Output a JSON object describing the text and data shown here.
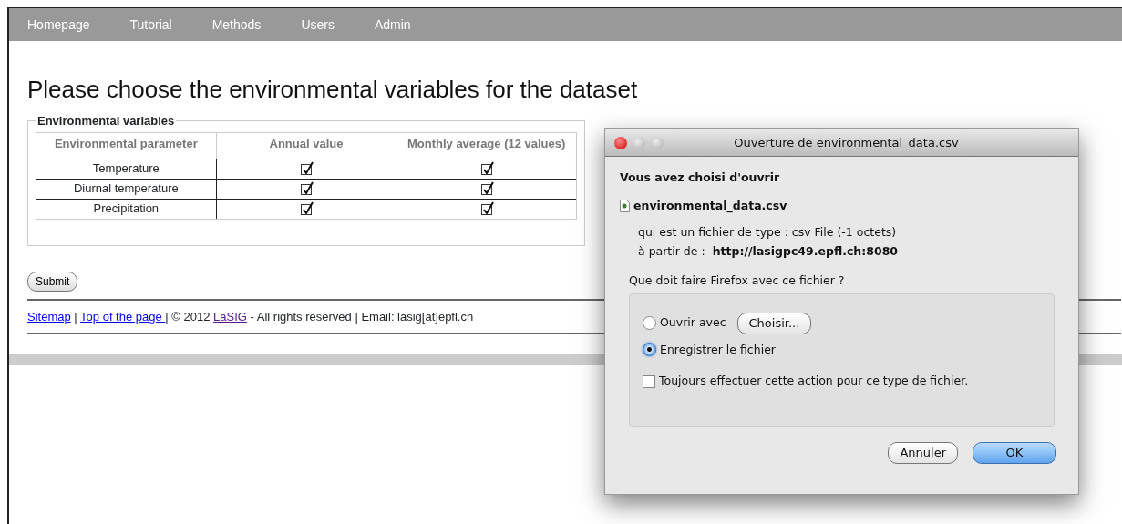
{
  "nav": {
    "items": [
      {
        "label": "Homepage"
      },
      {
        "label": "Tutorial"
      },
      {
        "label": "Methods"
      },
      {
        "label": "Users"
      },
      {
        "label": "Admin"
      }
    ]
  },
  "page": {
    "heading": "Please choose the environmental variables for the dataset",
    "fieldset": {
      "legend": "Environmental variables",
      "table": {
        "columns": [
          "Environmental parameter",
          "Annual value",
          "Monthly average (12 values)"
        ],
        "rows": [
          {
            "name": "Temperature",
            "annual_checked": true,
            "monthly_checked": true
          },
          {
            "name": "Diurnal temperature",
            "annual_checked": true,
            "monthly_checked": true
          },
          {
            "name": "Precipitation",
            "annual_checked": true,
            "monthly_checked": true
          }
        ]
      }
    },
    "submit": "Submit",
    "footer": [
      {
        "kind": "link",
        "text": "Sitemap",
        "visited": false
      },
      {
        "kind": "text",
        "text": " | "
      },
      {
        "kind": "link",
        "text": "Top of the page ",
        "visited": false
      },
      {
        "kind": "text",
        "text": "| © 2012 "
      },
      {
        "kind": "link",
        "text": "LaSIG",
        "visited": true
      },
      {
        "kind": "text",
        "text": " - All rights reserved | Email: lasig[at]epfl.ch"
      }
    ]
  },
  "dialog": {
    "title": "Ouverture de environmental_data.csv",
    "intro": "Vous avez choisi d'ouvrir",
    "filename": "environmental_data.csv",
    "type_line": "qui est un fichier de type :  csv File (-1 octets)",
    "from_label": "à partir de :",
    "from_url": "http://lasigpc49.epfl.ch:8080",
    "question": "Que doit faire Firefox avec ce fichier ?",
    "options": [
      {
        "label": "Ouvrir avec",
        "selected": false,
        "button": "Choisir..."
      },
      {
        "label": "Enregistrer le fichier",
        "selected": true
      }
    ],
    "always": {
      "label": "Toujours effectuer cette action pour ce type de fichier.",
      "checked": false
    },
    "buttons": [
      {
        "label": "Annuler",
        "kind": "cancel"
      },
      {
        "label": "OK",
        "kind": "default"
      }
    ]
  }
}
